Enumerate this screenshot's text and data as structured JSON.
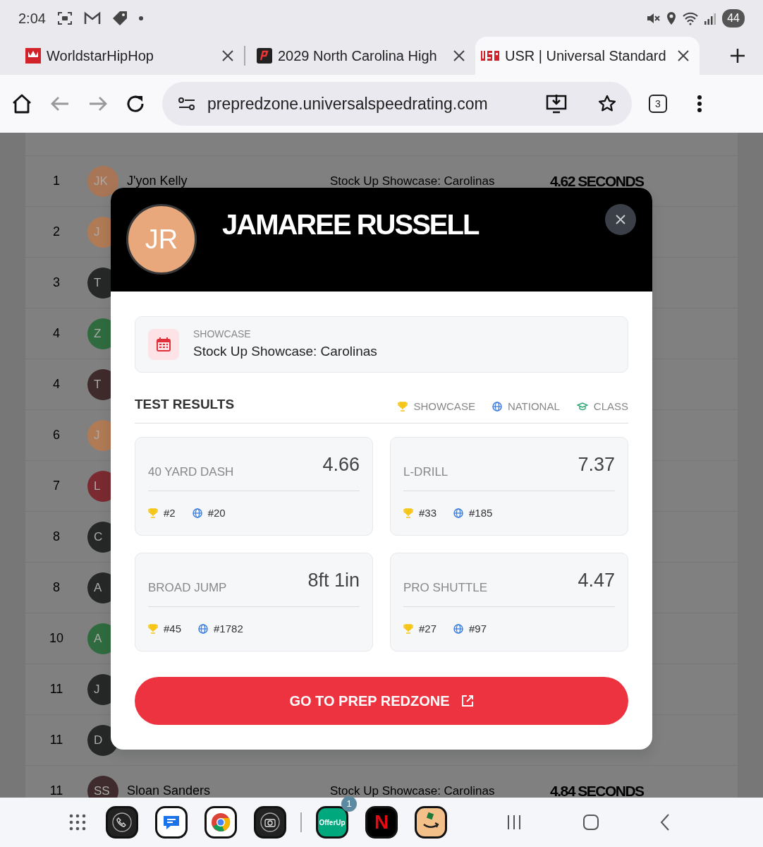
{
  "status_bar": {
    "time": "2:04",
    "battery": "44"
  },
  "browser_tabs": [
    {
      "title": "WorldstarHipHop",
      "selected": false
    },
    {
      "title": "2029 North Carolina High",
      "selected": false
    },
    {
      "title": "USR | Universal Standard",
      "selected": true
    }
  ],
  "address_bar": {
    "url": "prepredzone.universalspeedrating.com",
    "tab_count": "3"
  },
  "table": {
    "rows": [
      {
        "rank": "1",
        "initials": "JK",
        "color": "#a87556",
        "name": "J'yon Kelly",
        "showcase": "Stock Up Showcase: Carolinas",
        "result": "4.62 SECONDS"
      },
      {
        "rank": "2",
        "initials": "J",
        "color": "#b07a55"
      },
      {
        "rank": "3",
        "initials": "T",
        "color": "#262827"
      },
      {
        "rank": "4",
        "initials": "Z",
        "color": "#2f6b3f"
      },
      {
        "rank": "4",
        "initials": "T",
        "color": "#3f2a2c"
      },
      {
        "rank": "6",
        "initials": "J",
        "color": "#b07a55"
      },
      {
        "rank": "7",
        "initials": "L",
        "color": "#7a2a30"
      },
      {
        "rank": "8",
        "initials": "C",
        "color": "#262827"
      },
      {
        "rank": "8",
        "initials": "A",
        "color": "#262827"
      },
      {
        "rank": "10",
        "initials": "A",
        "color": "#2f6b3f"
      },
      {
        "rank": "11",
        "initials": "J",
        "color": "#262827"
      },
      {
        "rank": "11",
        "initials": "D",
        "color": "#262827"
      },
      {
        "rank": "11",
        "initials": "SS",
        "color": "#3f2b2e",
        "name": "Sloan Sanders",
        "showcase": "Stock Up Showcase: Carolinas",
        "result": "4.84 SECONDS"
      }
    ]
  },
  "modal": {
    "initials": "JR",
    "name": "JAMAREE RUSSELL",
    "showcase_label": "SHOWCASE",
    "showcase": "Stock Up Showcase: Carolinas",
    "section_title": "TEST RESULTS",
    "legend": [
      {
        "kind": "showcase",
        "label": "SHOWCASE"
      },
      {
        "kind": "national",
        "label": "NATIONAL"
      },
      {
        "kind": "class",
        "label": "CLASS"
      }
    ],
    "results": [
      {
        "label": "40 YARD DASH",
        "value": "4.66",
        "showcase_rank": "#2",
        "national_rank": "#20"
      },
      {
        "label": "L-DRILL",
        "value": "7.37",
        "showcase_rank": "#33",
        "national_rank": "#185"
      },
      {
        "label": "BROAD JUMP",
        "value": "8ft 1in",
        "showcase_rank": "#45",
        "national_rank": "#1782"
      },
      {
        "label": "PRO SHUTTLE",
        "value": "4.47",
        "showcase_rank": "#27",
        "national_rank": "#97"
      }
    ],
    "button": "GO TO PREP REDZONE"
  },
  "dock": {
    "apps": [
      {
        "kind": "phone"
      },
      {
        "kind": "messages"
      },
      {
        "kind": "chrome"
      },
      {
        "kind": "camera"
      },
      {
        "kind": "offerup",
        "label": "OfferUp",
        "badge": "1"
      },
      {
        "kind": "netflix",
        "label": "N"
      },
      {
        "kind": "amazon"
      }
    ]
  }
}
